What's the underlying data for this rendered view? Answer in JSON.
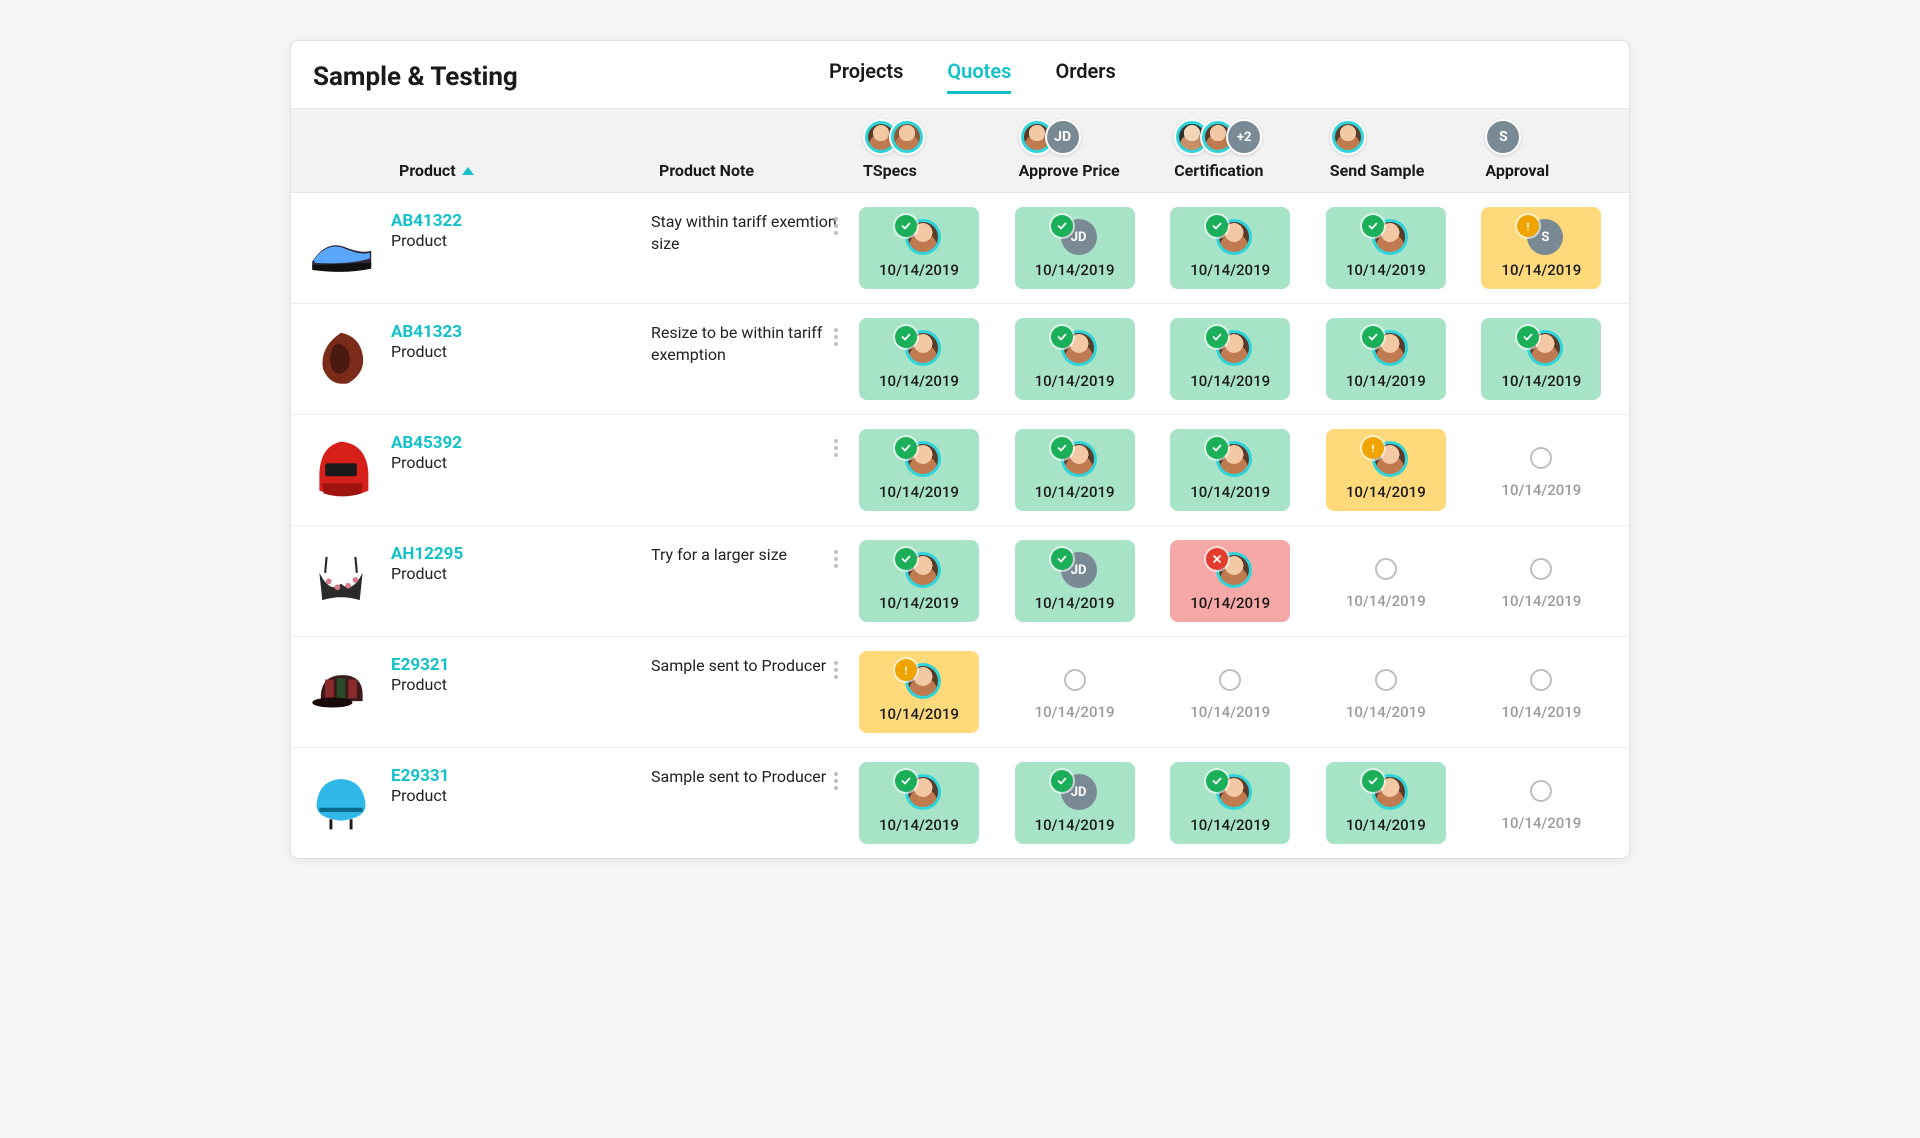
{
  "title": "Sample & Testing",
  "tabs": [
    {
      "label": "Projects",
      "active": false
    },
    {
      "label": "Quotes",
      "active": true
    },
    {
      "label": "Orders",
      "active": false
    }
  ],
  "columns": {
    "product": "Product",
    "note": "Product Note",
    "stages": [
      {
        "key": "tspecs",
        "label": "TSpecs",
        "avatars": [
          {
            "type": "face"
          },
          {
            "type": "face",
            "variant": "face2"
          }
        ]
      },
      {
        "key": "approve",
        "label": "Approve Price",
        "avatars": [
          {
            "type": "face"
          },
          {
            "type": "initials",
            "text": "JD"
          }
        ]
      },
      {
        "key": "cert",
        "label": "Certification",
        "avatars": [
          {
            "type": "face",
            "variant": "face3"
          },
          {
            "type": "face"
          },
          {
            "type": "plus",
            "text": "+2"
          }
        ]
      },
      {
        "key": "send",
        "label": "Send Sample",
        "avatars": [
          {
            "type": "face"
          }
        ]
      },
      {
        "key": "approval",
        "label": "Approval",
        "avatars": [
          {
            "type": "initials",
            "text": "S"
          }
        ]
      }
    ]
  },
  "rows": [
    {
      "sku": "AB41322",
      "type": "Product",
      "thumb": "shoe",
      "note": "Stay within tariff exemtion size",
      "stages": {
        "tspecs": {
          "status": "ok",
          "avatar": {
            "type": "face"
          },
          "date": "10/14/2019"
        },
        "approve": {
          "status": "ok",
          "avatar": {
            "type": "initials",
            "text": "JD"
          },
          "date": "10/14/2019"
        },
        "cert": {
          "status": "ok",
          "avatar": {
            "type": "face"
          },
          "date": "10/14/2019"
        },
        "send": {
          "status": "ok",
          "avatar": {
            "type": "face"
          },
          "date": "10/14/2019"
        },
        "approval": {
          "status": "warn",
          "avatar": {
            "type": "initials",
            "text": "S"
          },
          "date": "10/14/2019"
        }
      }
    },
    {
      "sku": "AB41323",
      "type": "Product",
      "thumb": "glove",
      "note": "Resize to be within tariff exemption",
      "stages": {
        "tspecs": {
          "status": "ok",
          "avatar": {
            "type": "face"
          },
          "date": "10/14/2019"
        },
        "approve": {
          "status": "ok",
          "avatar": {
            "type": "face"
          },
          "date": "10/14/2019"
        },
        "cert": {
          "status": "ok",
          "avatar": {
            "type": "face"
          },
          "date": "10/14/2019"
        },
        "send": {
          "status": "ok",
          "avatar": {
            "type": "face"
          },
          "date": "10/14/2019"
        },
        "approval": {
          "status": "ok",
          "avatar": {
            "type": "face"
          },
          "date": "10/14/2019"
        }
      }
    },
    {
      "sku": "AB45392",
      "type": "Product",
      "thumb": "helmet-red",
      "note": "",
      "stages": {
        "tspecs": {
          "status": "ok",
          "avatar": {
            "type": "face"
          },
          "date": "10/14/2019"
        },
        "approve": {
          "status": "ok",
          "avatar": {
            "type": "face"
          },
          "date": "10/14/2019"
        },
        "cert": {
          "status": "ok",
          "avatar": {
            "type": "face"
          },
          "date": "10/14/2019"
        },
        "send": {
          "status": "warn",
          "avatar": {
            "type": "face"
          },
          "date": "10/14/2019"
        },
        "approval": {
          "status": "none",
          "date": "10/14/2019"
        }
      }
    },
    {
      "sku": "AH12295",
      "type": "Product",
      "thumb": "bra",
      "note": "Try for a larger size",
      "stages": {
        "tspecs": {
          "status": "ok",
          "avatar": {
            "type": "face"
          },
          "date": "10/14/2019"
        },
        "approve": {
          "status": "ok",
          "avatar": {
            "type": "initials",
            "text": "JD"
          },
          "date": "10/14/2019"
        },
        "cert": {
          "status": "err",
          "avatar": {
            "type": "face"
          },
          "date": "10/14/2019"
        },
        "send": {
          "status": "none",
          "date": "10/14/2019"
        },
        "approval": {
          "status": "none",
          "date": "10/14/2019"
        }
      }
    },
    {
      "sku": "E29321",
      "type": "Product",
      "thumb": "cap",
      "note": "Sample sent to Producer",
      "stages": {
        "tspecs": {
          "status": "warn",
          "avatar": {
            "type": "face"
          },
          "date": "10/14/2019"
        },
        "approve": {
          "status": "none",
          "date": "10/14/2019"
        },
        "cert": {
          "status": "none",
          "date": "10/14/2019"
        },
        "send": {
          "status": "none",
          "date": "10/14/2019"
        },
        "approval": {
          "status": "none",
          "date": "10/14/2019"
        }
      }
    },
    {
      "sku": "E29331",
      "type": "Product",
      "thumb": "helmet-blue",
      "note": "Sample sent to Producer",
      "stages": {
        "tspecs": {
          "status": "ok",
          "avatar": {
            "type": "face"
          },
          "date": "10/14/2019"
        },
        "approve": {
          "status": "ok",
          "avatar": {
            "type": "initials",
            "text": "JD"
          },
          "date": "10/14/2019"
        },
        "cert": {
          "status": "ok",
          "avatar": {
            "type": "face"
          },
          "date": "10/14/2019"
        },
        "send": {
          "status": "ok",
          "avatar": {
            "type": "face"
          },
          "date": "10/14/2019"
        },
        "approval": {
          "status": "none",
          "date": "10/14/2019"
        }
      }
    }
  ]
}
